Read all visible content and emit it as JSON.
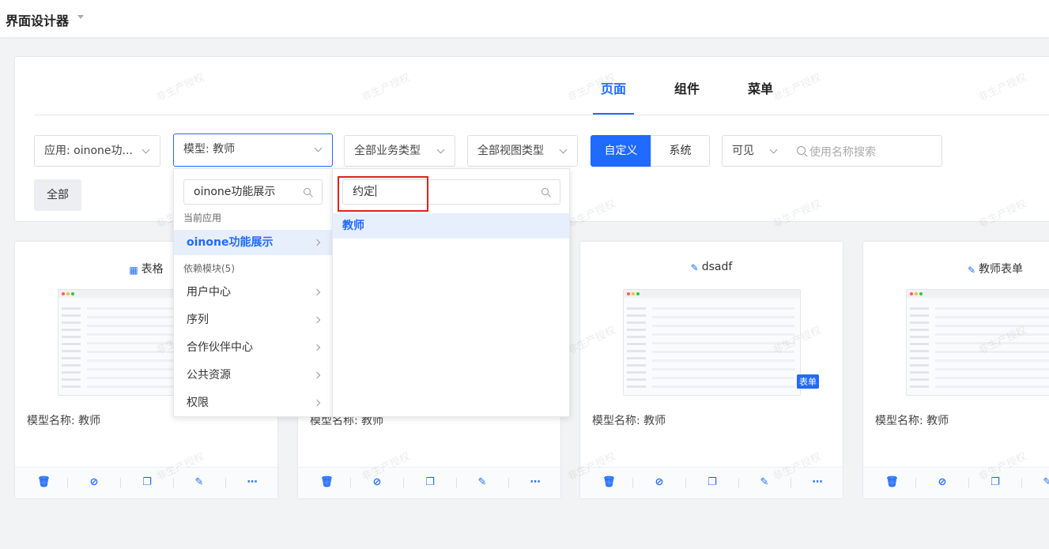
{
  "app": {
    "title": "界面设计器"
  },
  "tabs": [
    {
      "label": "页面",
      "active": true
    },
    {
      "label": "组件",
      "active": false
    },
    {
      "label": "菜单",
      "active": false
    }
  ],
  "filters": {
    "app_select": "应用: oinone功...",
    "model_select": "模型: 教师",
    "biz_type_select": "全部业务类型",
    "view_type_select": "全部视图类型",
    "source_toggle": [
      "自定义",
      "系统"
    ],
    "visibility_select": "可见",
    "search_placeholder": "使用名称搜索",
    "all_button": "全部"
  },
  "dropdown": {
    "left_search_value": "oinone功能展示",
    "current_app_group": "当前应用",
    "current_app_item": "oinone功能展示",
    "dependency_group": "依赖模块(5)",
    "dependency_items": [
      "用户中心",
      "序列",
      "合作伙伴中心",
      "公共资源",
      "权限"
    ],
    "right_search_value": "约定",
    "right_items": [
      "教师"
    ]
  },
  "cards": [
    {
      "title": "表格",
      "icon": "table-icon",
      "model": "模型名称: 教师",
      "badge": ""
    },
    {
      "title": "",
      "icon": "",
      "model": "模型名称: 教师",
      "badge": ""
    },
    {
      "title": "dsadf",
      "icon": "edit-icon",
      "model": "模型名称: 教师",
      "badge": "表单"
    },
    {
      "title": "教师表单",
      "icon": "edit-icon",
      "model": "模型名称: 教师",
      "badge": ""
    }
  ],
  "watermark_text": "非生产授权",
  "colors": {
    "primary": "#1f6aff",
    "highlight": "#e02020"
  }
}
